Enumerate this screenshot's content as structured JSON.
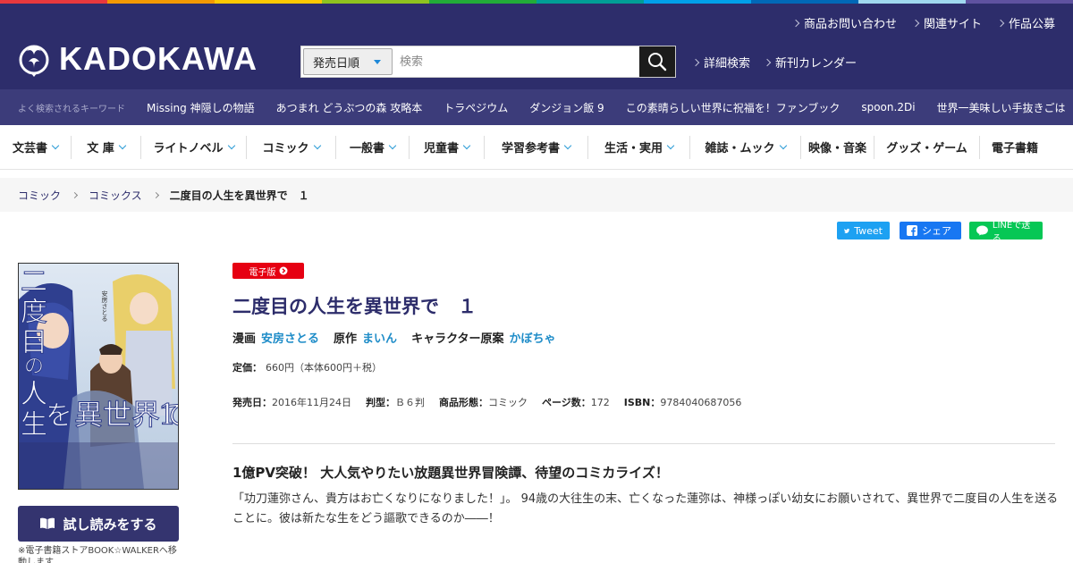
{
  "brand": {
    "logo_text": "KADOKAWA",
    "rainbow_colors": [
      "#e8383d",
      "#f39800",
      "#fcc800",
      "#8fc31f",
      "#22ac38",
      "#009e96",
      "#00a0e9",
      "#0068b7",
      "#a0d8ef",
      "#5f52a0"
    ]
  },
  "header": {
    "utility_links": [
      "商品お問い合わせ",
      "関連サイト",
      "作品公募"
    ],
    "search": {
      "select_label": "発売日順",
      "placeholder": "検索"
    },
    "links": [
      "詳細検索",
      "新刊カレンダー"
    ]
  },
  "keywords": {
    "label": "よく検索されるキーワード",
    "items": [
      "Missing 神隠しの物語",
      "あつまれ どうぶつの森 攻略本",
      "トラペジウム",
      "ダンジョン飯 9",
      "この素晴らしい世界に祝福を！ファンブック",
      "spoon.2Di",
      "世界一美味しい手抜きごは"
    ]
  },
  "categories": [
    {
      "label": "文芸書",
      "dropdown": true
    },
    {
      "label": "文 庫",
      "dropdown": true
    },
    {
      "label": "ライトノベル",
      "dropdown": true
    },
    {
      "label": "コミック",
      "dropdown": true
    },
    {
      "label": "一般書",
      "dropdown": true
    },
    {
      "label": "児童書",
      "dropdown": true
    },
    {
      "label": "学習参考書",
      "dropdown": true
    },
    {
      "label": "生活・実用",
      "dropdown": true
    },
    {
      "label": "雑誌・ムック",
      "dropdown": true
    },
    {
      "label": "映像・音楽",
      "dropdown": false
    },
    {
      "label": "グッズ・ゲーム",
      "dropdown": false
    },
    {
      "label": "電子書籍",
      "dropdown": false
    }
  ],
  "breadcrumb": [
    "コミック",
    "コミックス",
    "二度目の人生を異世界で　１"
  ],
  "share": {
    "tweet": "Tweet",
    "facebook": "シェア",
    "line": "LINEで送る"
  },
  "colors": {
    "header": "#2d2d6b",
    "keywords_bar": "#3c3c7a",
    "accent_blue": "#1e8cc8",
    "badge_red": "#e60012",
    "twitter": "#1da1f2",
    "facebook": "#1877f2",
    "line": "#06c755"
  },
  "product": {
    "badge": "電子版",
    "title": "二度目の人生を異世界で　１",
    "credits": [
      {
        "role": "漫画",
        "name": "安房さとる"
      },
      {
        "role": "原作",
        "name": "まいん"
      },
      {
        "role": "キャラクター原案",
        "name": "かぼちゃ"
      }
    ],
    "price_label": "定価：",
    "price_value": "660円（本体600円＋税）",
    "specs": [
      {
        "label": "発売日：",
        "value": "2016年11月24日"
      },
      {
        "label": "判型：",
        "value": "Ｂ６判"
      },
      {
        "label": "商品形態：",
        "value": "コミック"
      },
      {
        "label": "ページ数：",
        "value": "172"
      },
      {
        "label": "ISBN：",
        "value": "9784040687056"
      }
    ],
    "catch_copy": "1億PV突破！ 大人気やりたい放題異世界冒険譚、待望のコミカライズ！",
    "description": "「功刀蓮弥さん、貴方はお亡くなりになりました！」。 94歳の大往生の末、亡くなった蓮弥は、神様っぽい幼女にお願いされて、異世界で二度目の人生を送ることに。彼は新たな生をどう謳歌できるのか――！",
    "cover": {
      "title_text": "二度目の人生を異世界で1",
      "credit_text": "安房さとる"
    },
    "trial_button": "試し読みをする",
    "trial_note": "※電子書籍ストアBOOK☆WALKERへ移動します"
  }
}
